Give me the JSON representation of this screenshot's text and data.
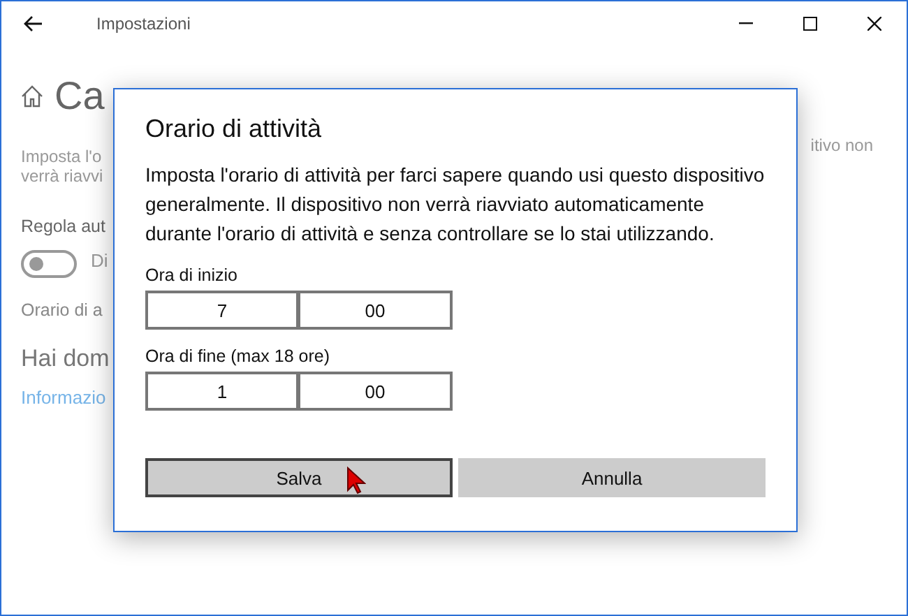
{
  "window": {
    "title": "Impostazioni"
  },
  "background": {
    "heading": "Ca",
    "line_1": "Imposta l'o",
    "line_1_end": "itivo non",
    "line_2": "verrà riavvi",
    "toggle_title": "Regola aut",
    "toggle": {
      "on": false,
      "label": "Di"
    },
    "field_label": "Orario di a",
    "help_heading": "Hai dom",
    "help_link": "Informazio"
  },
  "dialog": {
    "title": "Orario di attività",
    "text": "Imposta l'orario di attività per farci sapere quando usi questo dispositivo generalmente. Il dispositivo non verrà riavviato automaticamente durante l'orario di attività e senza controllare se lo stai utilizzando.",
    "fields": [
      {
        "label": "Ora di inizio",
        "hours": "7",
        "minutes": "00"
      },
      {
        "label": "Ora di fine (max 18 ore)",
        "hours": "1",
        "minutes": "00"
      }
    ],
    "buttons": [
      {
        "label": "Salva",
        "focused": true
      },
      {
        "label": "Annulla",
        "focused": false
      }
    ]
  }
}
